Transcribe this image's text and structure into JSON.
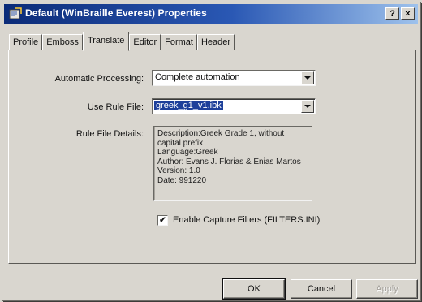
{
  "window": {
    "title": "Default (WinBraille Everest) Properties",
    "help_button": "?",
    "close_button": "×"
  },
  "tabs": [
    {
      "label": "Profile",
      "active": false
    },
    {
      "label": "Emboss",
      "active": false
    },
    {
      "label": "Translate",
      "active": true
    },
    {
      "label": "Editor",
      "active": false
    },
    {
      "label": "Format",
      "active": false
    },
    {
      "label": "Header",
      "active": false
    }
  ],
  "form": {
    "automatic_processing_label": "Automatic Processing:",
    "automatic_processing_value": "Complete automation",
    "use_rule_file_label": "Use Rule File:",
    "use_rule_file_value": "greek_g1_v1.ibk",
    "rule_file_details_label": "Rule File Details:",
    "rule_file_details_lines": [
      "Description:Greek Grade 1, without",
      "capital prefix",
      "Language:Greek",
      "Author: Evans J. Florias & Enias Martos",
      "Version: 1.0",
      "Date: 991220"
    ],
    "capture_filters_label": "Enable Capture Filters (FILTERS.INI)",
    "capture_filters_checked": true
  },
  "buttons": {
    "ok": "OK",
    "cancel": "Cancel",
    "apply": "Apply"
  },
  "colors": {
    "titlebar_start": "#0b2b78",
    "titlebar_end": "#9ec2ec",
    "selection": "#1d3f9a",
    "face": "#d9d6cf"
  },
  "icons": {
    "title": "application-icon",
    "dropdown": "chevron-down-icon",
    "check": "checkmark-icon"
  }
}
